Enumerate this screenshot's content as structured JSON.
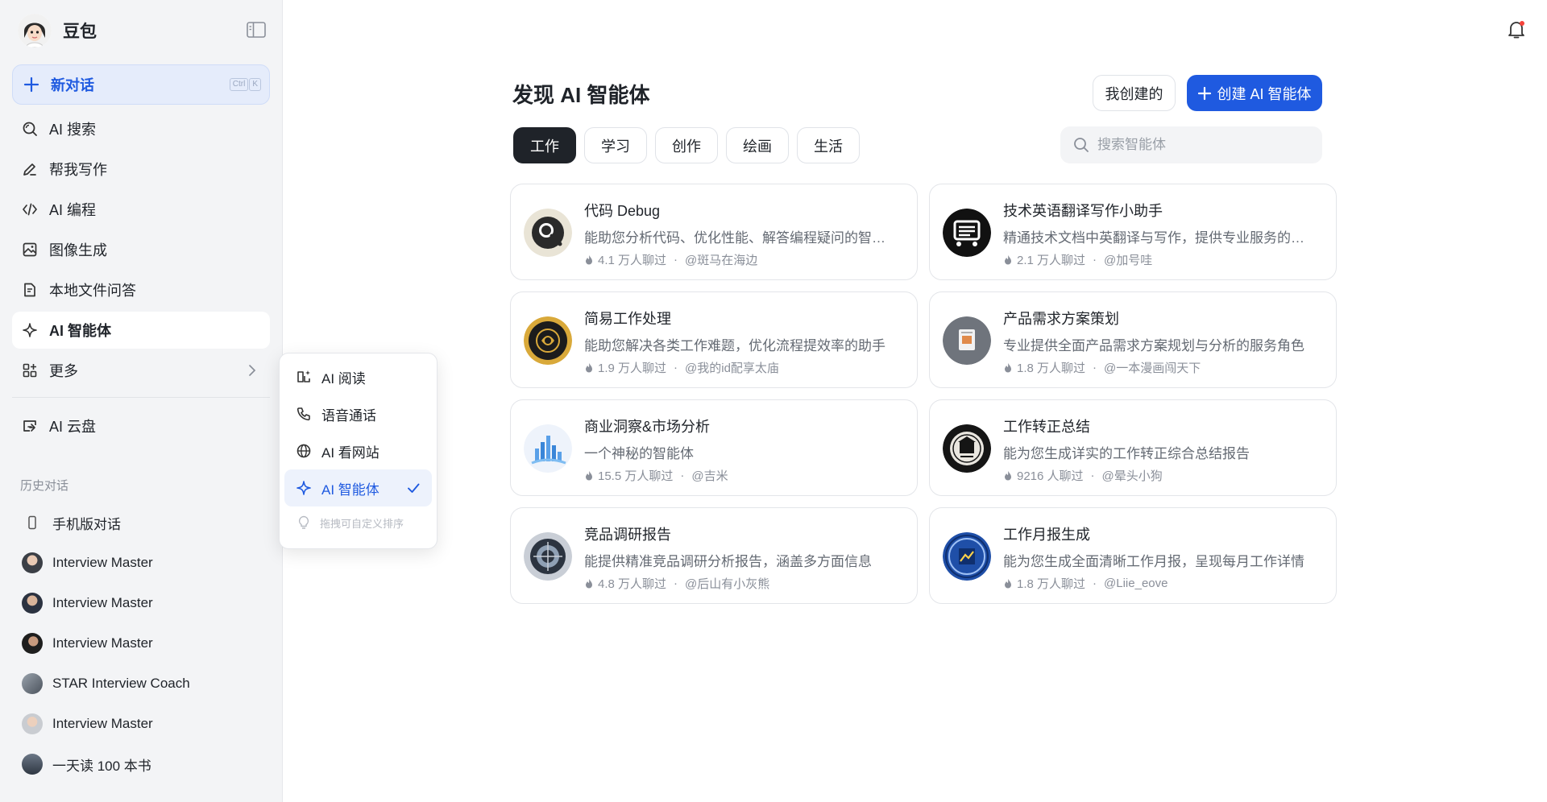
{
  "app": {
    "name": "豆包"
  },
  "sidebar": {
    "new_chat": {
      "label": "新对话",
      "shortcut": [
        "Ctrl",
        "K"
      ]
    },
    "items": [
      {
        "label": "AI 搜索",
        "icon": "search-icon"
      },
      {
        "label": "帮我写作",
        "icon": "pen-icon"
      },
      {
        "label": "AI 编程",
        "icon": "code-icon"
      },
      {
        "label": "图像生成",
        "icon": "image-icon"
      },
      {
        "label": "本地文件问答",
        "icon": "file-icon"
      },
      {
        "label": "AI 智能体",
        "icon": "sparkle-icon",
        "active": true
      },
      {
        "label": "更多",
        "icon": "grid-icon"
      }
    ],
    "cloud": {
      "label": "AI 云盘",
      "icon": "cloud-drive-icon"
    },
    "history_title": "历史对话",
    "history": [
      {
        "label": "手机版对话",
        "icon": "phone-icon"
      },
      {
        "label": "Interview Master"
      },
      {
        "label": "Interview Master"
      },
      {
        "label": "Interview Master"
      },
      {
        "label": "STAR Interview Coach"
      },
      {
        "label": "Interview Master"
      },
      {
        "label": "一天读 100 本书"
      }
    ]
  },
  "popup": {
    "items": [
      {
        "label": "AI 阅读",
        "icon": "reader-icon"
      },
      {
        "label": "语音通话",
        "icon": "phone-call-icon"
      },
      {
        "label": "AI 看网站",
        "icon": "globe-icon"
      },
      {
        "label": "AI 智能体",
        "icon": "sparkle-icon",
        "selected": true
      }
    ],
    "hint": "拖拽可自定义排序"
  },
  "main": {
    "title": "发现 AI 智能体",
    "my_created": "我创建的",
    "create": "创建 AI 智能体",
    "tabs": [
      "工作",
      "学习",
      "创作",
      "绘画",
      "生活"
    ],
    "active_tab": 0,
    "search_placeholder": "搜索智能体",
    "cards": [
      {
        "title": "代码 Debug",
        "desc": "能助您分析代码、优化性能、解答编程疑问的智能助手",
        "chats": "4.1 万人聊过",
        "author": "@斑马在海边"
      },
      {
        "title": "技术英语翻译写作小助手",
        "desc": "精通技术文档中英翻译与写作，提供专业服务的智能助手",
        "chats": "2.1 万人聊过",
        "author": "@加号哇"
      },
      {
        "title": "简易工作处理",
        "desc": "能助您解决各类工作难题，优化流程提效率的助手",
        "chats": "1.9 万人聊过",
        "author": "@我的id配享太庙"
      },
      {
        "title": "产品需求方案策划",
        "desc": "专业提供全面产品需求方案规划与分析的服务角色",
        "chats": "1.8 万人聊过",
        "author": "@一本漫画闯天下"
      },
      {
        "title": "商业洞察&市场分析",
        "desc": "一个神秘的智能体",
        "chats": "15.5 万人聊过",
        "author": "@吉米"
      },
      {
        "title": "工作转正总结",
        "desc": "能为您生成详实的工作转正综合总结报告",
        "chats": "9216 人聊过",
        "author": "@晕头小狗"
      },
      {
        "title": "竞品调研报告",
        "desc": "能提供精准竞品调研分析报告，涵盖多方面信息",
        "chats": "4.8 万人聊过",
        "author": "@后山有小灰熊"
      },
      {
        "title": "工作月报生成",
        "desc": "能为您生成全面清晰工作月报，呈现每月工作详情",
        "chats": "1.8 万人聊过",
        "author": "@Liie_eove"
      }
    ]
  },
  "colors": {
    "accent": "#1f5ae0",
    "sidebar_bg": "#f3f4f6",
    "active_tab": "#1f2329"
  }
}
